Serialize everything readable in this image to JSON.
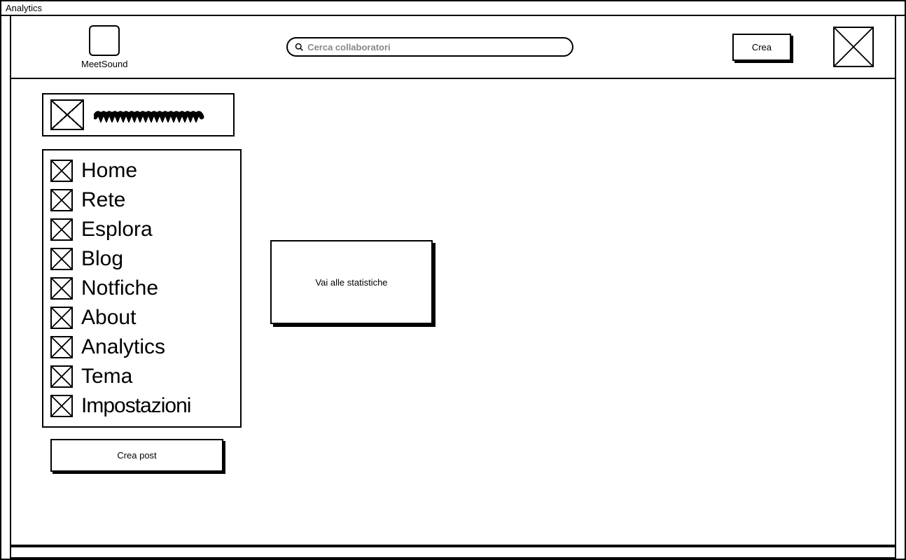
{
  "window": {
    "title": "Analytics"
  },
  "header": {
    "app_name": "MeetSound",
    "search_placeholder": "Cerca collaboratori",
    "create_label": "Crea"
  },
  "sidebar": {
    "nav": [
      {
        "label": "Home"
      },
      {
        "label": "Rete"
      },
      {
        "label": "Esplora"
      },
      {
        "label": "Blog"
      },
      {
        "label": "Notfiche"
      },
      {
        "label": "About"
      },
      {
        "label": "Analytics"
      },
      {
        "label": "Tema"
      },
      {
        "label": "Impostazioni"
      }
    ],
    "create_post_label": "Crea post"
  },
  "main": {
    "stats_button_label": "Vai alle statistiche"
  }
}
